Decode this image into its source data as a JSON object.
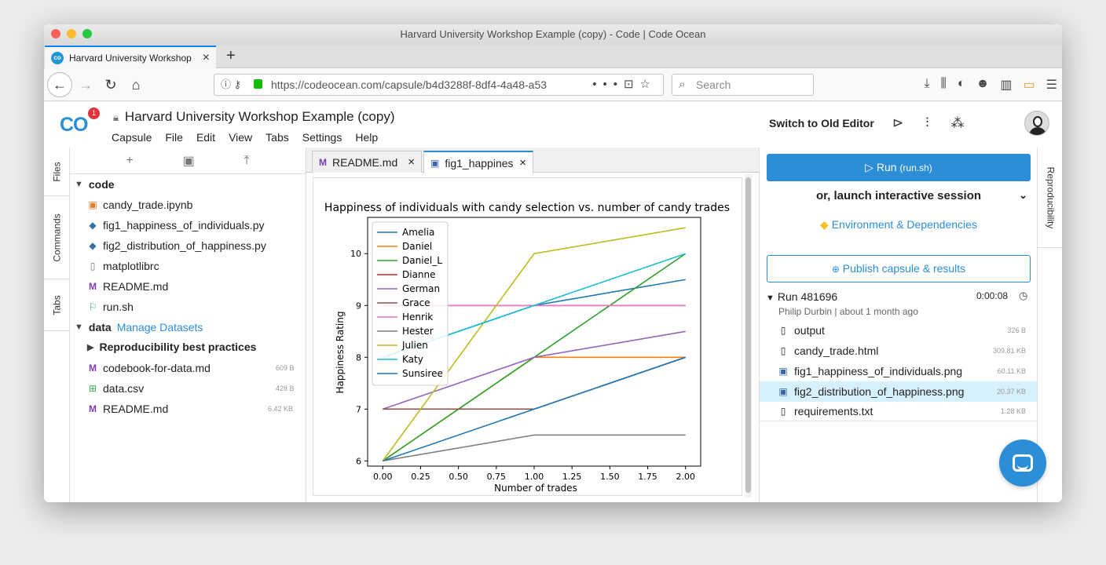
{
  "browser": {
    "window_title": "Harvard University Workshop Example (copy) - Code | Code Ocean",
    "tab_title": "Harvard University Workshop Ex",
    "url": "https://codeocean.com/capsule/b4d3288f-8df4-4a48-a53",
    "search_placeholder": "Search"
  },
  "app": {
    "logo": "CO",
    "notification_count": "1",
    "capsule_title": "Harvard University Workshop Example (copy)",
    "menu": [
      "Capsule",
      "File",
      "Edit",
      "View",
      "Tabs",
      "Settings",
      "Help"
    ],
    "switch_editor": "Switch to Old Editor"
  },
  "left_rail": [
    "Files",
    "Commands",
    "Tabs"
  ],
  "right_rail": [
    "Reproducibility"
  ],
  "files": {
    "code_folder": "code",
    "code_items": [
      {
        "name": "candy_trade.ipynb",
        "icon": "notebook-icon"
      },
      {
        "name": "fig1_happiness_of_individuals.py",
        "icon": "python-icon"
      },
      {
        "name": "fig2_distribution_of_happiness.py",
        "icon": "python-icon"
      },
      {
        "name": "matplotlibrc",
        "icon": "file-icon"
      },
      {
        "name": "README.md",
        "icon": "markdown-icon"
      },
      {
        "name": "run.sh",
        "icon": "flag-icon"
      }
    ],
    "data_folder": "data",
    "manage_datasets": "Manage Datasets",
    "data_subfolder": "Reproducibility best practices",
    "data_items": [
      {
        "name": "codebook-for-data.md",
        "size": "609 B",
        "icon": "markdown-icon"
      },
      {
        "name": "data.csv",
        "size": "428 B",
        "icon": "table-icon"
      },
      {
        "name": "README.md",
        "size": "6.42 KB",
        "icon": "markdown-icon"
      }
    ]
  },
  "editor": {
    "tabs": [
      "README.md",
      "fig1_happines"
    ]
  },
  "chart_data": {
    "type": "line",
    "title": "Happiness of individuals with candy selection vs. number of candy trades",
    "xlabel": "Number of trades",
    "ylabel": "Happiness Rating",
    "x": [
      0,
      1,
      2
    ],
    "xlim": [
      -0.1,
      2.1
    ],
    "ylim": [
      5.9,
      10.7
    ],
    "xticks": [
      "0.00",
      "0.25",
      "0.50",
      "0.75",
      "1.00",
      "1.25",
      "1.50",
      "1.75",
      "2.00"
    ],
    "yticks": [
      "6",
      "7",
      "8",
      "9",
      "10"
    ],
    "legend_position": "upper-left",
    "series": [
      {
        "name": "Amelia",
        "color": "#1f77b4",
        "values": [
          8,
          9,
          9.5
        ]
      },
      {
        "name": "Daniel",
        "color": "#ff7f0e",
        "values": [
          6,
          8,
          8
        ]
      },
      {
        "name": "Daniel_L",
        "color": "#2ca02c",
        "values": [
          6,
          8,
          10
        ]
      },
      {
        "name": "Dianne",
        "color": "#d62728",
        "values": [
          9,
          9,
          9
        ]
      },
      {
        "name": "German",
        "color": "#9467bd",
        "values": [
          7,
          8,
          8.5
        ]
      },
      {
        "name": "Grace",
        "color": "#8c564b",
        "values": [
          7,
          7,
          8
        ]
      },
      {
        "name": "Henrik",
        "color": "#e377c2",
        "values": [
          9,
          9,
          9
        ]
      },
      {
        "name": "Hester",
        "color": "#7f7f7f",
        "values": [
          6,
          6.5,
          6.5
        ]
      },
      {
        "name": "Julien",
        "color": "#bcbd22",
        "values": [
          6,
          10,
          10.5
        ]
      },
      {
        "name": "Katy",
        "color": "#17becf",
        "values": [
          8,
          9,
          10
        ]
      },
      {
        "name": "Sunsiree",
        "color": "#1f77b4",
        "values": [
          6,
          7,
          8
        ]
      }
    ]
  },
  "reproducibility": {
    "run_label": "Run",
    "run_script": "(run.sh)",
    "launch_label": "or, launch interactive session",
    "env_label": "Environment & Dependencies",
    "publish_label": "Publish capsule & results",
    "run_id": "Run 481696",
    "run_time": "0:00:08",
    "run_meta": "Philip Durbin | about 1 month ago",
    "outputs": [
      {
        "name": "output",
        "size": "326 B",
        "icon": "file-icon",
        "selected": false
      },
      {
        "name": "candy_trade.html",
        "size": "309.81 KB",
        "icon": "file-icon",
        "selected": false
      },
      {
        "name": "fig1_happiness_of_individuals.png",
        "size": "60.11 KB",
        "icon": "image-icon",
        "selected": false
      },
      {
        "name": "fig2_distribution_of_happiness.png",
        "size": "20.37 KB",
        "icon": "image-icon",
        "selected": true
      },
      {
        "name": "requirements.txt",
        "size": "1.28 KB",
        "icon": "file-icon",
        "selected": false
      }
    ]
  },
  "colors": {
    "accent": "#2b8ed6",
    "selected_row": "#d7f1fc"
  }
}
